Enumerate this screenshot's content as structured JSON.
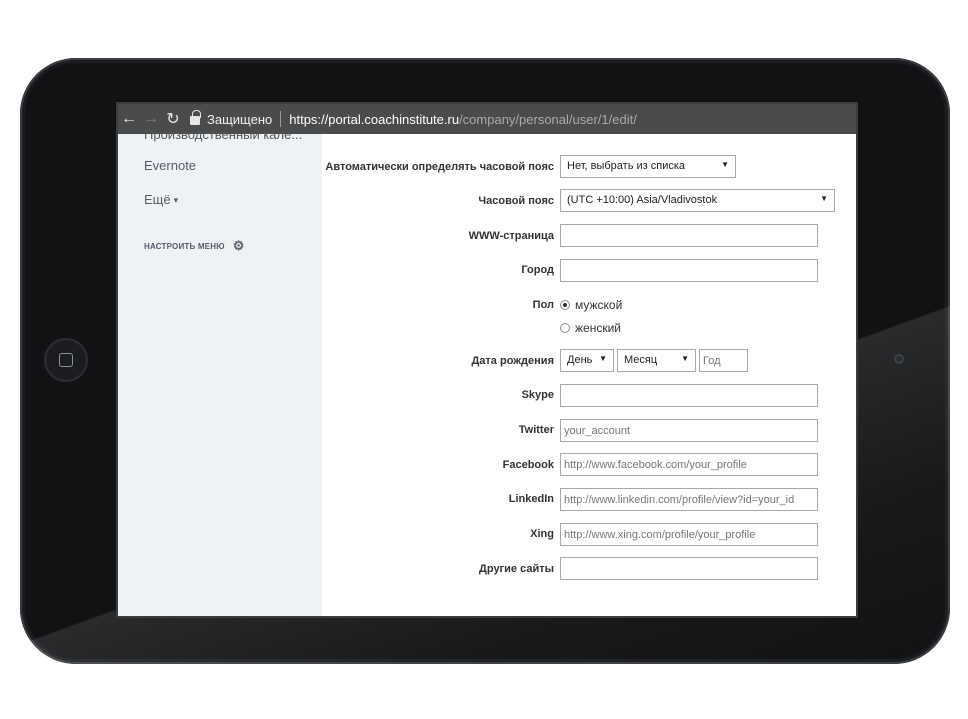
{
  "browser": {
    "back_icon": "arrow-left-icon",
    "forward_icon": "arrow-right-icon",
    "reload_icon": "reload-icon",
    "secure_label": "Защищено",
    "url_scheme": "https://",
    "url_host": "portal.coachinstitute.ru",
    "url_path": "/company/personal/user/1/edit/"
  },
  "sidebar": {
    "cut_item": "Производственный кале...",
    "items": [
      {
        "label": "Evernote"
      },
      {
        "label": "Ещё"
      }
    ],
    "settings_label": "НАСТРОИТЬ МЕНЮ"
  },
  "form": {
    "auto_timezone": {
      "label": "Автоматически определять часовой пояс",
      "value": "Нет, выбрать из списка"
    },
    "timezone": {
      "label": "Часовой пояс",
      "value": "(UTC +10:00) Asia/Vladivostok"
    },
    "www": {
      "label": "WWW-страница",
      "value": ""
    },
    "city": {
      "label": "Город",
      "value": ""
    },
    "gender": {
      "label": "Пол",
      "options": [
        "мужской",
        "женский"
      ],
      "selected": "мужской"
    },
    "birthdate": {
      "label": "Дата рождения",
      "day": "День",
      "month": "Месяц",
      "year_placeholder": "Год"
    },
    "skype": {
      "label": "Skype",
      "value": ""
    },
    "twitter": {
      "label": "Twitter",
      "placeholder": "your_account"
    },
    "facebook": {
      "label": "Facebook",
      "placeholder": "http://www.facebook.com/your_profile"
    },
    "linkedin": {
      "label": "LinkedIn",
      "placeholder": "http://www.linkedin.com/profile/view?id=your_id"
    },
    "xing": {
      "label": "Xing",
      "placeholder": "http://www.xing.com/profile/your_profile"
    },
    "other_sites": {
      "label": "Другие сайты",
      "value": ""
    }
  },
  "colors": {
    "bezel": "#111214",
    "address_bar": "#4a4b4d",
    "sidebar_bg": "#eef2f4"
  }
}
